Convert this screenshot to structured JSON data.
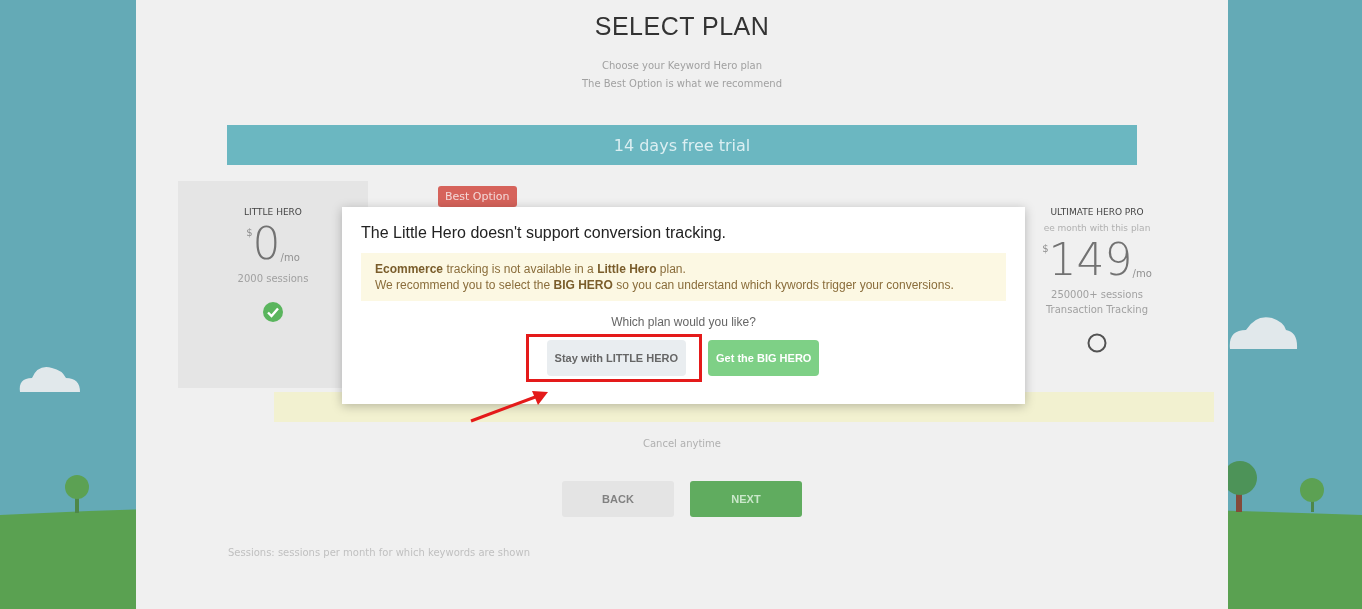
{
  "page": {
    "title": "SELECT PLAN",
    "subtitle_lines": [
      "Choose your Keyword Hero plan",
      "The Best Option is what we recommend"
    ],
    "trial_banner": "14 days free trial",
    "best_option_badge": "Best Option"
  },
  "plans": [
    {
      "name": "LITTLE HERO",
      "currency": "$",
      "price": "0",
      "period": "/mo",
      "features": [
        "2000 sessions"
      ],
      "selected": true
    },
    {
      "name": "ULTIMATE HERO PRO",
      "note": "ee month with this plan",
      "currency": "$",
      "price": "149",
      "period": "/mo",
      "features": [
        "250000+ sessions",
        "Transaction Tracking"
      ],
      "selected": false
    }
  ],
  "cancel_note": "Cancel anytime",
  "nav_buttons": [
    "BACK",
    "NEXT"
  ],
  "footnote": "Sessions: sessions per month for which keywords are shown",
  "dialog": {
    "title": "The Little Hero doesn't support conversion tracking.",
    "warning_lines": [
      "**Ecommerce** tracking is not available in a **Little Hero** plan.",
      "We recommend you to select the **BIG HERO** so you can understand which kywords trigger your conversions."
    ],
    "question": "Which plan would you like?",
    "buttons": [
      {
        "label": "Stay with LITTLE HERO",
        "kind": "secondary",
        "highlighted": true
      },
      {
        "label": "Get the BIG HERO",
        "kind": "primary",
        "highlighted": false
      }
    ]
  }
}
